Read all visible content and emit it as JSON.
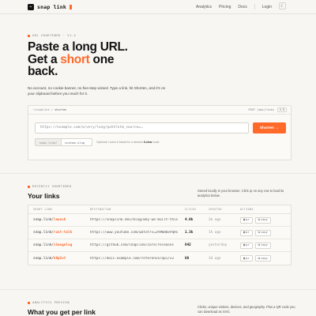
{
  "header": {
    "brand_mark": "⌁",
    "brand_name": "snap link",
    "nav": [
      "Analytics",
      "Pricing",
      "Docs"
    ],
    "login": "Login",
    "theme_icon": "moon-icon"
  },
  "hero": {
    "eyebrow": "URL SHORTENER · V1.4",
    "title_line1": "Paste a long URL.",
    "title_line2_pre": "Get a ",
    "title_line2_accent": "short",
    "title_line2_post": " one",
    "title_line3": "back.",
    "subtitle": "No account, no cookie banner, no five-step wizard. Type a link, hit Shorten, and it's on your clipboard before you reach for it."
  },
  "shortener": {
    "path_prefix": "~/snaplink",
    "path_tail": "shorten",
    "endpoint": "POST /api/links",
    "kbd": "⌘ K",
    "url_placeholder": "https://example.com/a/very/long/path?utm_source=…",
    "button_label": "Shorten →",
    "slug_prefix": "snap.link/",
    "slug_placeholder": "custom-slug",
    "slug_hint_pre": "Optional. Leave it blank for a random ",
    "slug_hint_bold": "6-char",
    "slug_hint_post": " code."
  },
  "links": {
    "eyebrow": "RECENTLY SHORTENED",
    "title": "Your links",
    "note": "Stored locally in your browser. Click qr on any row to load its analytics below.",
    "columns": [
      "SHORT LINK",
      "DESTINATION",
      "CLICKS",
      "CREATED",
      "ACTIONS"
    ],
    "rows": [
      {
        "prefix": "snap.link/",
        "slug": "launch",
        "dest": "https://snaplink.dev/blog/why-we-built-this",
        "clicks": "4.0k",
        "created": "2m ago"
      },
      {
        "prefix": "snap.link/",
        "slug": "rust-talk",
        "dest": "https://www.youtube.com/watch?v=2h9Wd0xPqRs",
        "clicks": "1.3k",
        "created": "1h ago"
      },
      {
        "prefix": "snap.link/",
        "slug": "changelog",
        "dest": "https://github.com/snaplink/core/releases",
        "clicks": "642",
        "created": "yesterday"
      },
      {
        "prefix": "snap.link/",
        "slug": "k9p2vt",
        "dest": "https://docs.example.com/reference/api/v2",
        "clicks": "88",
        "created": "3d ago"
      }
    ],
    "qr_label": "qr",
    "copy_label": "copy"
  },
  "analytics": {
    "eyebrow": "ANALYTICS PREVIEW",
    "title": "What you get per link",
    "note": "Clicks, unique visitors, devices, and geography. Plus a QR code you can download as SVG."
  }
}
